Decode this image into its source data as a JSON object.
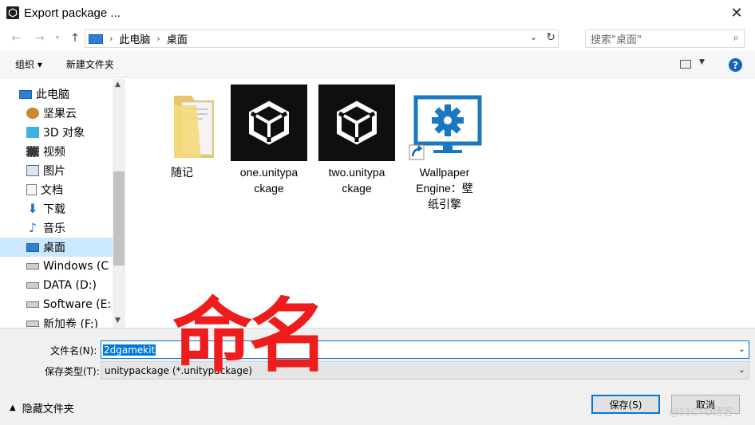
{
  "window": {
    "title": "Export package ...",
    "close_glyph": "✕"
  },
  "address": {
    "pc_label": "此电脑",
    "current": "桌面"
  },
  "search": {
    "placeholder": "搜索\"桌面\""
  },
  "toolbar": {
    "organize": "组织 ▾",
    "new_folder": "新建文件夹",
    "help": "?"
  },
  "nav": {
    "items": [
      {
        "label": "此电脑",
        "icon": "pc-icon"
      },
      {
        "label": "坚果云",
        "icon": "nutstore-icon"
      },
      {
        "label": "3D 对象",
        "icon": "3d-objects-icon"
      },
      {
        "label": "视频",
        "icon": "video-icon"
      },
      {
        "label": "图片",
        "icon": "pictures-icon"
      },
      {
        "label": "文档",
        "icon": "documents-icon"
      },
      {
        "label": "下载",
        "icon": "download-icon"
      },
      {
        "label": "音乐",
        "icon": "music-icon"
      },
      {
        "label": "桌面",
        "icon": "desktop-icon",
        "selected": true
      },
      {
        "label": "Windows (C",
        "icon": "drive-icon"
      },
      {
        "label": "DATA (D:)",
        "icon": "drive-icon"
      },
      {
        "label": "Software (E:",
        "icon": "drive-icon"
      },
      {
        "label": "新加卷 (F:)",
        "icon": "drive-icon"
      }
    ]
  },
  "files": [
    {
      "name": "随记",
      "type": "folder"
    },
    {
      "name": "one.unitypa\nckage",
      "type": "unitypackage"
    },
    {
      "name": "two.unitypa\nckage",
      "type": "unitypackage"
    },
    {
      "name": "Wallpaper\nEngine：壁\n纸引擎",
      "type": "shortcut"
    }
  ],
  "form": {
    "filename_label": "文件名(N):",
    "filename_value": "2dgamekit",
    "filetype_label": "保存类型(T):",
    "filetype_value": "unitypackage (*.unitypackage)"
  },
  "footer": {
    "hide_folders": "隐藏文件夹",
    "save": "保存(S)",
    "cancel": "取消"
  },
  "annotation": "命名",
  "watermark": "@51CTO博客",
  "colors": {
    "accent": "#0078d7",
    "selection": "#cce8ff",
    "annotation": "#ee1c1c"
  }
}
